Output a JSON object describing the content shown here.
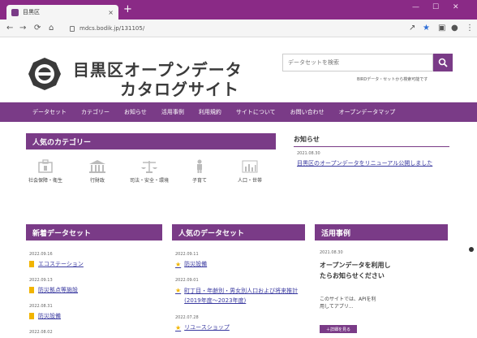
{
  "browser": {
    "tab_title": "目黒区",
    "tab_close": "×",
    "new_tab": "+",
    "url": "mdcs.bodik.jp/131105/",
    "controls": {
      "minimize": "—",
      "maximize": "☐",
      "close": "✕"
    }
  },
  "header": {
    "title_line1": "目黒区オープンデータ",
    "title_line2": "カタログサイト",
    "search_placeholder": "データセットを検索",
    "search_note": "BIRDデータ・セットから検索可能です"
  },
  "nav": [
    "データセット",
    "カテゴリー",
    "お知らせ",
    "活用事例",
    "利用規約",
    "サイトについて",
    "お問い合わせ",
    "オープンデータマップ"
  ],
  "categories": {
    "heading": "人気のカテゴリー",
    "items": [
      {
        "label": "社会保障・衛生",
        "icon": "social-security-icon"
      },
      {
        "label": "行財政",
        "icon": "government-building-icon"
      },
      {
        "label": "司法・安全・環境",
        "icon": "scales-icon"
      },
      {
        "label": "子育て",
        "icon": "child-icon"
      },
      {
        "label": "人口・世帯",
        "icon": "bar-chart-icon"
      }
    ]
  },
  "news": {
    "heading": "お知らせ",
    "date": "2021.08.30",
    "text": "目黒区のオープンデータをリニューアル公開しました"
  },
  "new_datasets": {
    "heading": "新着データセット",
    "items": [
      {
        "date": "2022.09.16",
        "title": "エコステーション"
      },
      {
        "date": "2022.09.13",
        "title": "防災拠点等施設"
      },
      {
        "date": "2022.08.31",
        "title": "防災設備"
      },
      {
        "date": "2022.08.02",
        "title": ""
      }
    ]
  },
  "popular_datasets": {
    "heading": "人気のデータセット",
    "items": [
      {
        "date": "2022.09.11",
        "title": "防災設備"
      },
      {
        "date": "2022.09.01",
        "title": "町丁目・年齢別・男女別人口および将来推計(2019年度〜2023年度)"
      },
      {
        "date": "2022.07.28",
        "title": "リユースショップ"
      }
    ]
  },
  "usecase": {
    "heading": "活用事例",
    "date": "2021.08.30",
    "title": "オープンデータを利用したらお知らせください",
    "body": "このサイトでは、APIを利用してアプリ...",
    "button": "＋詳細を見る"
  },
  "colors": {
    "brand": "#7a3b87",
    "titlebar": "#8a2a86",
    "accent_icon": "#f1b400"
  }
}
